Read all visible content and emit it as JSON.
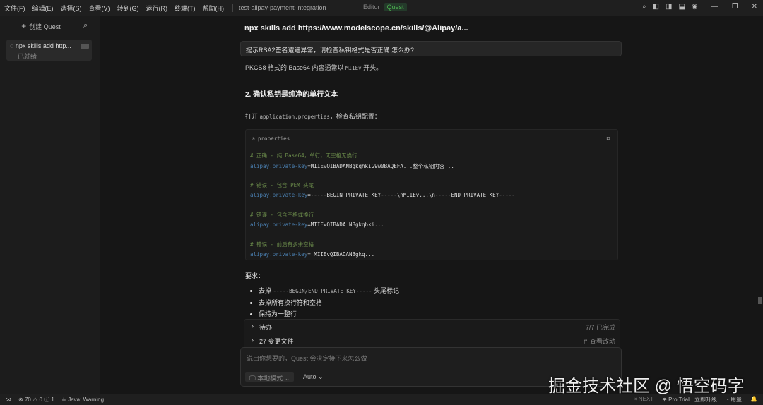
{
  "menu": [
    "文件(F)",
    "编辑(E)",
    "选择(S)",
    "查看(V)",
    "转到(G)",
    "运行(R)",
    "终端(T)",
    "帮助(H)"
  ],
  "project": "test-alipay-payment-integration",
  "modes": {
    "editor": "Editor",
    "quest": "Quest"
  },
  "sidebar": {
    "new_quest": "创建 Quest",
    "item": {
      "title": "npx skills add http...",
      "status": "已就绪"
    }
  },
  "chat": {
    "title": "npx skills add https://www.modelscope.cn/skills/@Alipay/a...",
    "question": "提示RSA2签名遭遇异常，请检查私钥格式是否正确 怎么办?",
    "p1a": "PKCS8 格式的 Base64 内容通常以 ",
    "p1code": "MIIEv",
    "p1b": " 开头。",
    "h2": "2. 确认私钥是纯净的单行文本",
    "p2a": "打开 ",
    "p2code": "application.properties",
    "p2b": "，检查私钥配置：",
    "code": {
      "lang": "properties",
      "lines": [
        {
          "c": "# 正确 - 纯 Base64，单行，无空格无换行"
        },
        {
          "k": "alipay.private-key",
          "v": "=MIIEvQIBADANBgkqhkiG9w0BAQEFA...整个私钥内容..."
        },
        {
          "c": "# 错误 - 包含 PEM 头尾"
        },
        {
          "k": "alipay.private-key",
          "v": "=-----BEGIN PRIVATE KEY-----\\nMIIEv...\\n-----END PRIVATE KEY-----"
        },
        {
          "c": "# 错误 - 包含空格或换行"
        },
        {
          "k": "alipay.private-key",
          "v": "=MIIEvQIBADA NBgkqhki..."
        },
        {
          "c": "# 错误 - 前后有多余空格"
        },
        {
          "k": "alipay.private-key",
          "v": "= MIIEvQIBADANBgkq..."
        }
      ]
    },
    "req": "要求：",
    "bullets": [
      {
        "a": "去掉 ",
        "code": "-----BEGIN/END PRIVATE KEY-----",
        "b": " 头尾标记"
      },
      {
        "a": "去掉所有换行符和空格"
      },
      {
        "a": "保持为一整行"
      }
    ]
  },
  "panel": {
    "todo": "待办",
    "todo_status": "7/7 已完成",
    "changes": "27 变更文件",
    "view_changes": "查看改动"
  },
  "input": {
    "placeholder": "说出你想要的，Quest 会决定接下来怎么做",
    "mode": "本地模式",
    "model": "Auto"
  },
  "status": {
    "errors": "70",
    "warnings": "0",
    "info": "1",
    "java": "Java: Warning",
    "next": "NEXT",
    "pro": "Pro Trial · 立即升级",
    "usage": "用量"
  },
  "watermark": "掘金技术社区 @ 悟空码字"
}
